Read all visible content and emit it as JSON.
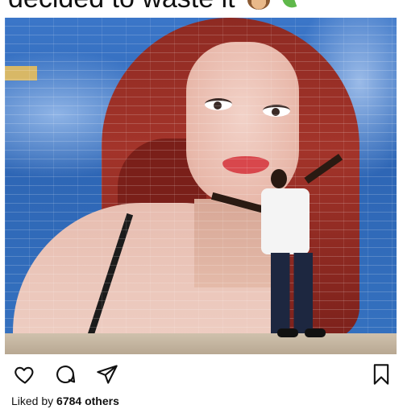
{
  "post": {
    "caption_text": "decided to waste it",
    "caption_emojis": [
      "see-no-evil-monkey-icon",
      "leaf-icon"
    ],
    "likes_prefix": "Liked by ",
    "likes_count": "6784 others"
  },
  "actions": {
    "like_icon": "heart-icon",
    "comment_icon": "comment-icon",
    "share_icon": "send-icon",
    "save_icon": "bookmark-icon"
  }
}
